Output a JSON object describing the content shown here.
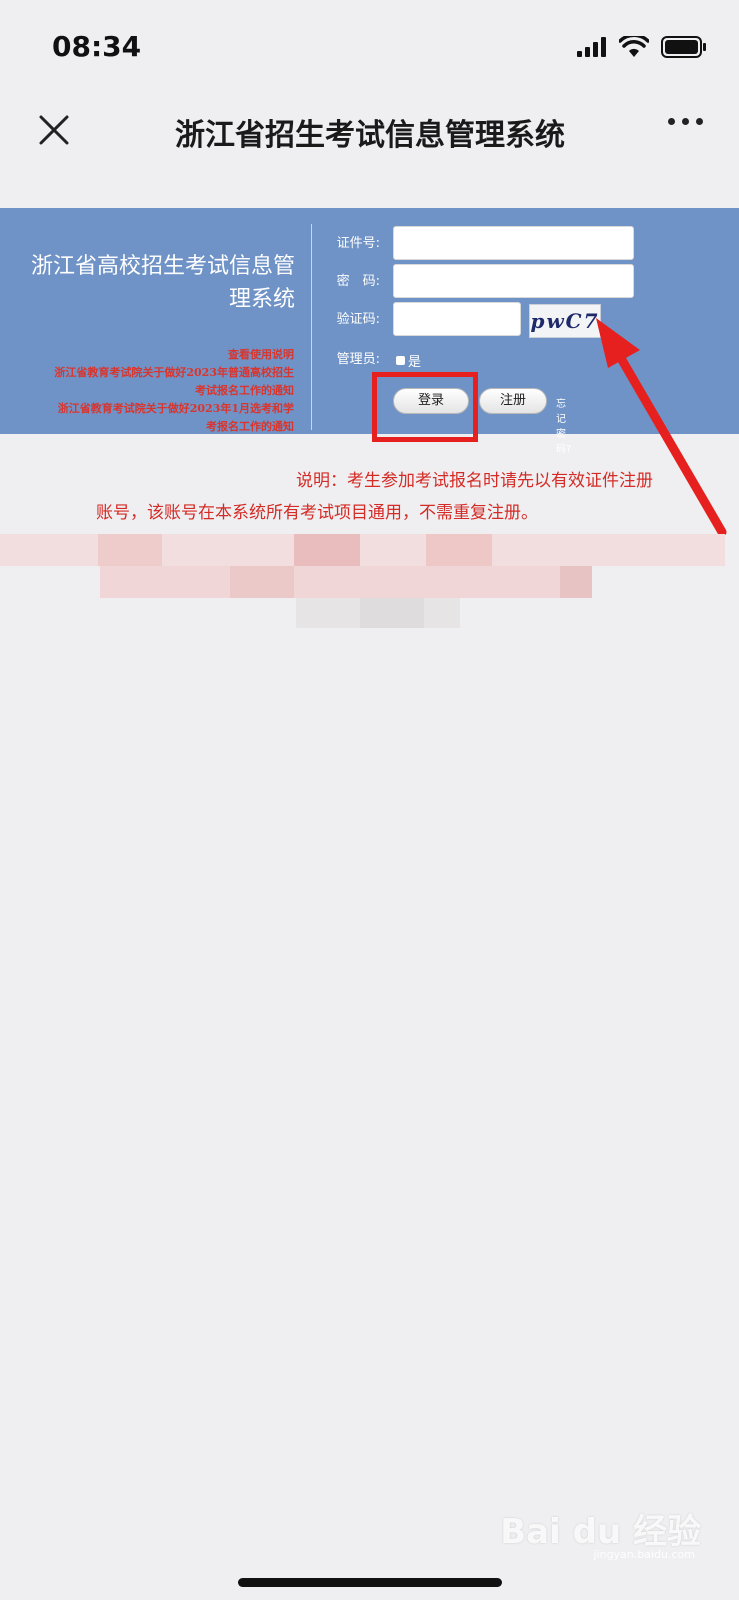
{
  "status_bar": {
    "time": "08:34",
    "icons": [
      "cellular-signal-icon",
      "wifi-icon",
      "battery-icon"
    ]
  },
  "nav": {
    "title": "浙江省招生考试信息管理系统",
    "close_icon": "close-icon",
    "more_icon": "more-icon"
  },
  "banner": {
    "title_line1": "浙江省高校招生考试信息管",
    "title_line2": "理系统",
    "notices": [
      "查看使用说明",
      "浙江省教育考试院关于做好2023年普通高校招生",
      "考试报名工作的通知",
      "浙江省教育考试院关于做好2023年1月选考和学",
      "考报名工作的通知"
    ],
    "background_color": "#6f93c6"
  },
  "form": {
    "id_label": "证件号:",
    "password_label": "密　码:",
    "captcha_label": "验证码:",
    "captcha_text": "pwC7",
    "admin_label": "管理员:",
    "admin_option": "是",
    "login_button": "登录",
    "register_button": "注册",
    "forgot_link": "忘记密码?"
  },
  "description": {
    "line1": "说明：考生参加考试报名时请先以有效证件注册",
    "line2": "账号，该账号在本系统所有考试项目通用，不需重复注册。"
  },
  "annotation": {
    "color": "#e5201f"
  },
  "watermark": {
    "brand": "Bai du 经验",
    "url": "jingyan.baidu.com"
  }
}
